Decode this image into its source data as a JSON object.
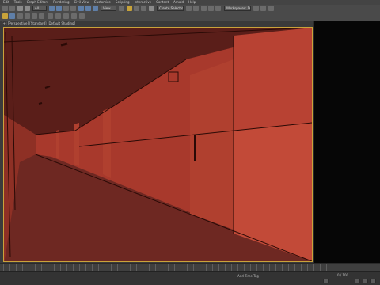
{
  "menubar": {
    "items": [
      "Edit",
      "Tools",
      "Graph Editors",
      "Rendering",
      "Civil View",
      "Customize",
      "Scripting",
      "Interactive",
      "Content",
      "Arnold",
      "Help"
    ]
  },
  "toolbar": {
    "filter_dropdown_value": "All",
    "view_dropdown_value": "View",
    "selection_set_value": "Create Selection Se",
    "workspace_value": "Workspaces: Default"
  },
  "viewport": {
    "label": "[+] [Perspective] [Standard] [Default Shading]"
  },
  "timeline": {
    "frame_counter": "0 / 100"
  },
  "status": {
    "message": "Add Time Tag",
    "frame_label": "Auto Key"
  },
  "colors": {
    "wall_main": "#a8392c",
    "wall_light": "#c24a38",
    "floor": "#6e2822",
    "ceiling": "#5a1e19",
    "edge": "#2a0a06",
    "viewport_border": "#caa33a"
  }
}
